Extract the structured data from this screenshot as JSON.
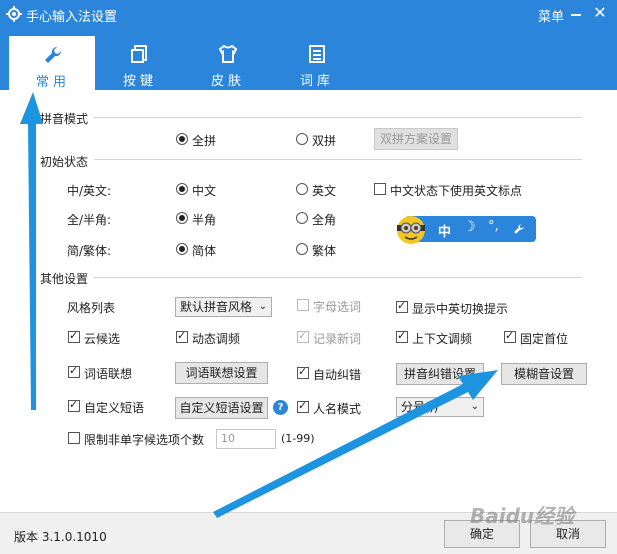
{
  "window": {
    "title": "手心输入法设置",
    "menu_label": "菜单",
    "accent_color": "#2b86db"
  },
  "tabs": [
    {
      "label": "常用",
      "icon": "wrench-icon",
      "active": true
    },
    {
      "label": "按键",
      "icon": "keyboard-icon",
      "active": false
    },
    {
      "label": "皮肤",
      "icon": "tshirt-icon",
      "active": false
    },
    {
      "label": "词库",
      "icon": "dictionary-icon",
      "active": false
    }
  ],
  "pinyin_mode": {
    "section": "拼音模式",
    "full_pinyin": "全拼",
    "double_pinyin": "双拼",
    "scheme_button": "双拼方案设置",
    "selected": "全拼"
  },
  "initial_state": {
    "section": "初始状态",
    "cn_en_label": "中/英文:",
    "cn": "中文",
    "en": "英文",
    "cn_en_selected": "中文",
    "punct_check": "中文状态下使用英文标点",
    "punct_checked": false,
    "width_label": "全/半角:",
    "half": "半角",
    "full": "全角",
    "width_selected": "半角",
    "script_label": "简/繁体:",
    "simplified": "简体",
    "traditional": "繁体",
    "script_selected": "简体",
    "status_bar_text": "中"
  },
  "other_settings": {
    "section": "其他设置",
    "style_label": "风格列表",
    "style_value": "默认拼音风格",
    "letter_select": "字母选词",
    "show_switch_tip": "显示中英切换提示",
    "cloud_candidate": "云候选",
    "dynamic_freq": "动态调频",
    "record_new_words": "记录新词",
    "context_freq": "上下文调频",
    "fixed_first": "固定首位",
    "word_association": "词语联想",
    "word_association_button": "词语联想设置",
    "auto_correct": "自动纠错",
    "pinyin_correct_button": "拼音纠错设置",
    "fuzzy_button": "模糊音设置",
    "custom_phrase": "自定义短语",
    "custom_phrase_button": "自定义短语设置",
    "name_mode": "人名模式",
    "name_mode_select": "分号(;)",
    "limit_label": "限制非单字候选项个数",
    "limit_value": "10",
    "limit_range": "(1-99)"
  },
  "footer": {
    "version": "版本 3.1.0.1010",
    "ok": "确定",
    "cancel": "取消"
  },
  "watermark": "Baidu经验"
}
